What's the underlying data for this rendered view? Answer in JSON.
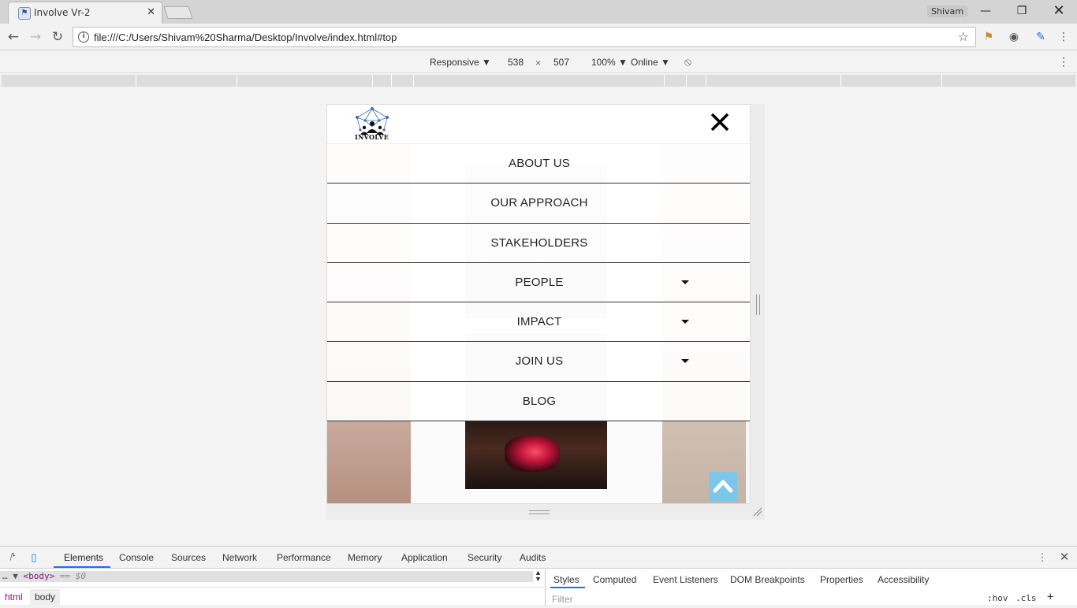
{
  "browser": {
    "tab_title": "Involve Vr-2",
    "tab_close": "✕",
    "profile_name": "Shivam",
    "url": "file:///C:/Users/Shivam%20Sharma/Desktop/Involve/index.html#top"
  },
  "device_toolbar": {
    "mode": "Responsive ▼",
    "width": "538",
    "times": "×",
    "height": "507",
    "zoom": "100% ▼",
    "network": "Online ▼"
  },
  "site": {
    "logo_text": "INVOLVE",
    "menu": [
      {
        "label": "ABOUT US",
        "has_dropdown": false
      },
      {
        "label": "OUR APPROACH",
        "has_dropdown": false
      },
      {
        "label": "STAKEHOLDERS",
        "has_dropdown": false
      },
      {
        "label": "PEOPLE",
        "has_dropdown": true
      },
      {
        "label": "IMPACT",
        "has_dropdown": true
      },
      {
        "label": "JOIN US",
        "has_dropdown": true
      },
      {
        "label": "BLOG",
        "has_dropdown": false
      }
    ],
    "colors": {
      "scroll_top_button": "#7cc6ea",
      "menu_divider": "#333333"
    }
  },
  "devtools": {
    "tabs": [
      "Elements",
      "Console",
      "Sources",
      "Network",
      "Performance",
      "Memory",
      "Application",
      "Security",
      "Audits"
    ],
    "selected_node_prefix": "… ▼",
    "selected_node_tag": "<body>",
    "selected_node_suffix": "== $0",
    "breadcrumbs": [
      "html",
      "body"
    ],
    "side_tabs": [
      "Styles",
      "Computed",
      "Event Listeners",
      "DOM Breakpoints",
      "Properties",
      "Accessibility"
    ],
    "filter_placeholder": "Filter",
    "hov": ":hov",
    "cls": ".cls",
    "plus": "+"
  }
}
